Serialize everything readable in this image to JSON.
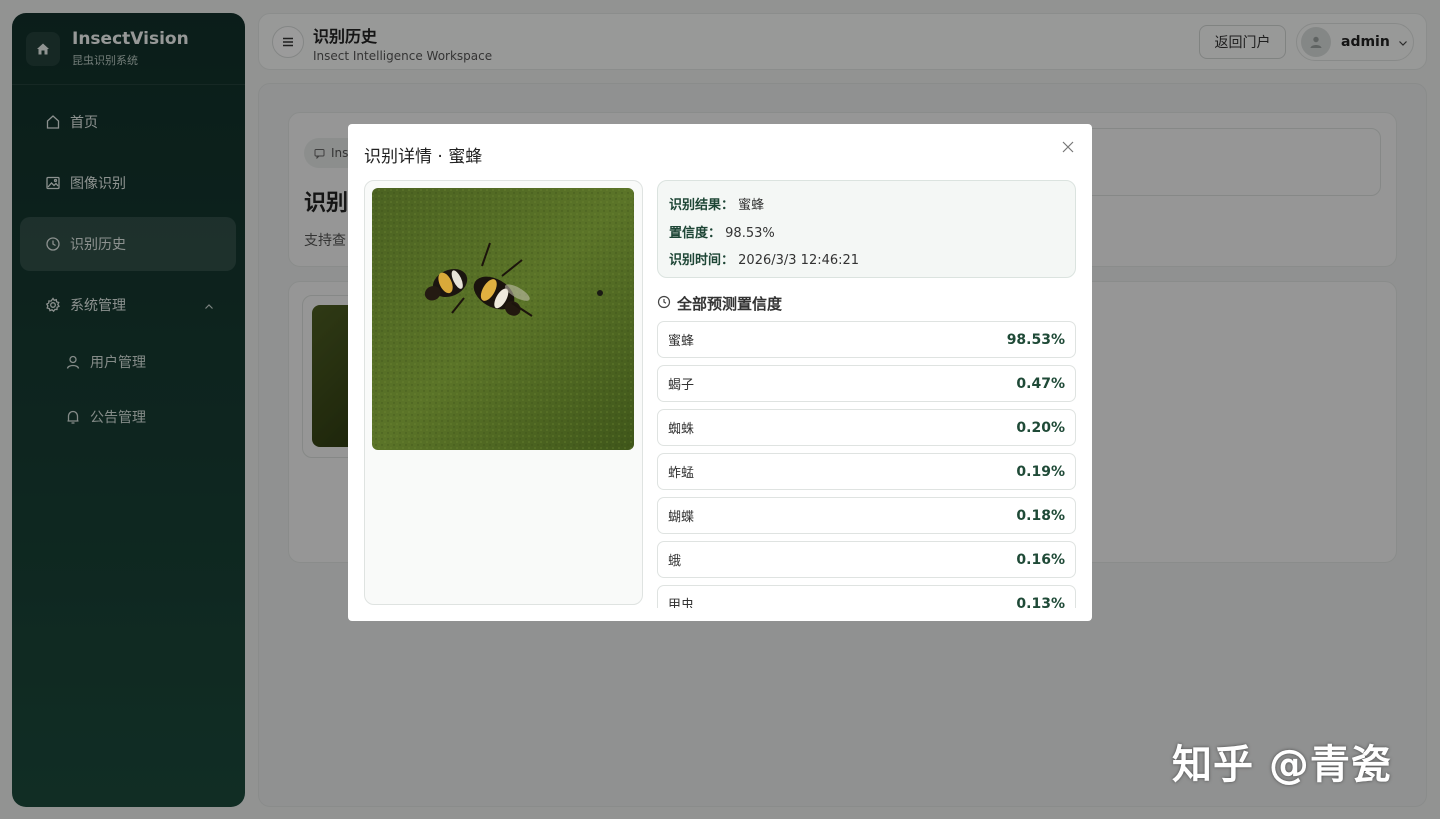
{
  "brand": {
    "title": "InsectVision",
    "subtitle": "昆虫识别系统"
  },
  "sidebar": {
    "items": [
      {
        "label": "首页",
        "icon": "home-icon"
      },
      {
        "label": "图像识别",
        "icon": "image-icon"
      },
      {
        "label": "识别历史",
        "icon": "clock-icon",
        "active": true
      },
      {
        "label": "系统管理",
        "icon": "gear-icon",
        "expanded": true
      }
    ],
    "sub_items": [
      {
        "label": "用户管理",
        "icon": "user-icon"
      },
      {
        "label": "公告管理",
        "icon": "bell-icon"
      }
    ]
  },
  "header": {
    "title": "识别历史",
    "subtitle": "Insect Intelligence Workspace",
    "portal_label": "返回门户",
    "user_name": "admin"
  },
  "background": {
    "chip_label": "Ins",
    "title": "识别",
    "description": "支持查"
  },
  "modal": {
    "title": "识别详情 · 蜜蜂",
    "result_label": "识别结果：",
    "result_value": "蜜蜂",
    "confidence_label": "置信度：",
    "confidence_value": "98.53%",
    "time_label": "识别时间：",
    "time_value": "2026/3/3 12:46:21",
    "predictions_heading": "全部预测置信度",
    "predictions": [
      {
        "name": "蜜蜂",
        "value": "98.53%"
      },
      {
        "name": "蝎子",
        "value": "0.47%"
      },
      {
        "name": "蜘蛛",
        "value": "0.20%"
      },
      {
        "name": "蚱蜢",
        "value": "0.19%"
      },
      {
        "name": "蝴蝶",
        "value": "0.18%"
      },
      {
        "name": "蛾",
        "value": "0.16%"
      },
      {
        "name": "甲虫",
        "value": "0.13%"
      }
    ]
  },
  "watermark": "知乎 @青瓷",
  "colors": {
    "sidebar": "#173d33",
    "accent": "#1f4a37",
    "overlay": "rgba(0,0,0,0.38)"
  }
}
